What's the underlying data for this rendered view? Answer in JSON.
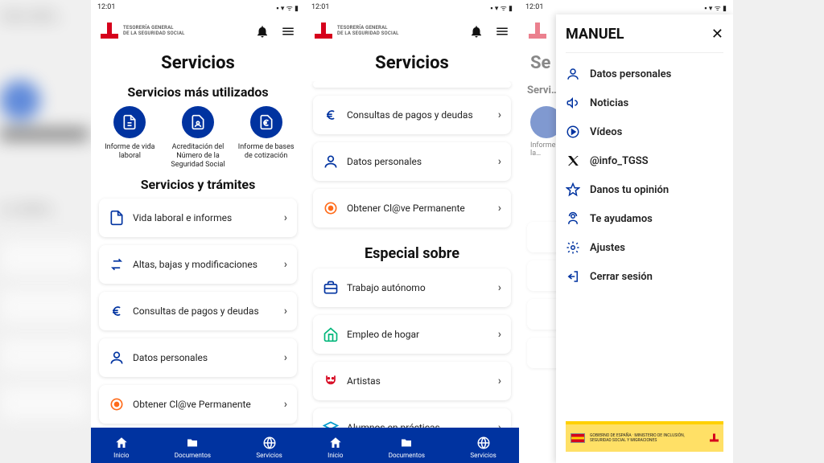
{
  "status": {
    "time": "12:01"
  },
  "brand": {
    "line1": "TESORERÍA GENERAL",
    "line2": "DE LA SEGURIDAD SOCIAL"
  },
  "page_title": "Servicios",
  "sections": {
    "most_used": "Servicios más utilizados",
    "services": "Servicios y trámites",
    "special": "Especial sobre"
  },
  "quick": {
    "items": [
      {
        "label": "Informe de vida laboral"
      },
      {
        "label": "Acreditación del Número de la Seguridad Social"
      },
      {
        "label": "Informe de bases de cotización"
      }
    ]
  },
  "list": {
    "items": [
      {
        "label": "Vida laboral e informes"
      },
      {
        "label": "Altas, bajas y modificaciones"
      },
      {
        "label": "Consultas de pagos y deudas"
      },
      {
        "label": "Datos personales"
      },
      {
        "label": "Obtener Cl@ve Permanente"
      }
    ]
  },
  "special": {
    "items": [
      {
        "label": "Trabajo autónomo"
      },
      {
        "label": "Empleo de hogar"
      },
      {
        "label": "Artistas"
      },
      {
        "label": "Alumnos en prácticas"
      }
    ]
  },
  "nav": {
    "home": "Inicio",
    "docs": "Documentos",
    "services": "Servicios"
  },
  "drawer": {
    "title": "MANUEL",
    "items": [
      {
        "label": "Datos personales"
      },
      {
        "label": "Noticias"
      },
      {
        "label": "Vídeos"
      },
      {
        "label": "@info_TGSS"
      },
      {
        "label": "Danos tu opinión"
      },
      {
        "label": "Te ayudamos"
      },
      {
        "label": "Ajustes"
      },
      {
        "label": "Cerrar sesión"
      }
    ],
    "footer": "GOBIERNO DE ESPAÑA · MINISTERIO DE INCLUSIÓN, SEGURIDAD SOCIAL Y MIGRACIONES"
  },
  "colors": {
    "primary_blue": "#0033a0",
    "brand_red": "#d6001c",
    "accent_orange": "#ff6b1a"
  }
}
